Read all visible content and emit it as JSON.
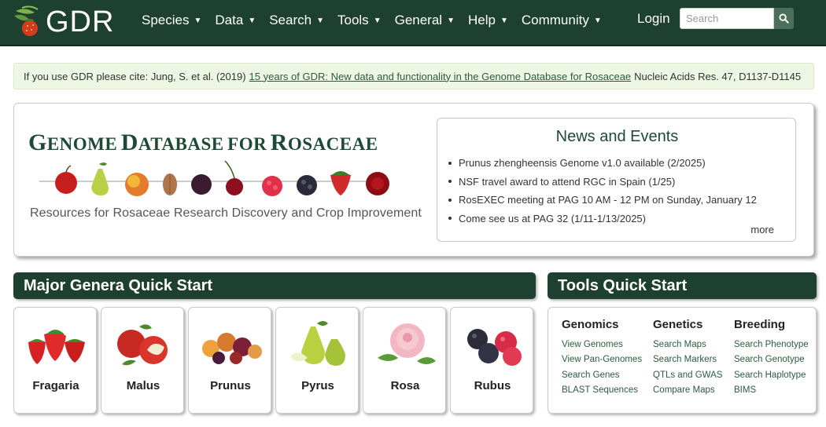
{
  "nav": {
    "logo_text": "GDR",
    "items": [
      "Species",
      "Data",
      "Search",
      "Tools",
      "General",
      "Help",
      "Community"
    ],
    "login": "Login",
    "search_placeholder": "Search"
  },
  "citation": {
    "prefix": "If you use GDR please cite:  Jung, S. et al. (2019)",
    "link_text": "15 years of GDR: New data and functionality in the Genome Database for Rosaceae",
    "suffix": "Nucleic Acids Res. 47, D1137-D1145"
  },
  "hero": {
    "title_words": [
      "Genome",
      "Database",
      "for",
      "Rosaceae"
    ],
    "tagline": "Resources for Rosaceae Research Discovery and Crop Improvement"
  },
  "news": {
    "title": "News and Events",
    "items": [
      "Prunus zhengheensis Genome v1.0 available (2/2025)",
      "NSF travel award to attend RGC in Spain (1/25)",
      "RosEXEC meeting at PAG 10 AM - 12 PM on Sunday, January 12",
      "Come see us at PAG 32 (1/11-1/13/2025)"
    ],
    "more": "more"
  },
  "genera": {
    "title": "Major Genera Quick Start",
    "items": [
      "Fragaria",
      "Malus",
      "Prunus",
      "Pyrus",
      "Rosa",
      "Rubus"
    ]
  },
  "tools": {
    "title": "Tools Quick Start",
    "columns": [
      {
        "heading": "Genomics",
        "links": [
          "View Genomes",
          "View Pan-Genomes",
          "Search Genes",
          "BLAST Sequences"
        ]
      },
      {
        "heading": "Genetics",
        "links": [
          "Search Maps",
          "Search Markers",
          "QTLs and GWAS",
          "Compare Maps"
        ]
      },
      {
        "heading": "Breeding",
        "links": [
          "Search Phenotype",
          "Search Genotype",
          "Search Haplotype",
          "BIMS"
        ]
      }
    ]
  },
  "colors": {
    "nav_bg": "#1e4030",
    "accent_green": "#1e4a35",
    "link_green": "#2c5b3e",
    "cite_bg": "#eef7e3"
  }
}
